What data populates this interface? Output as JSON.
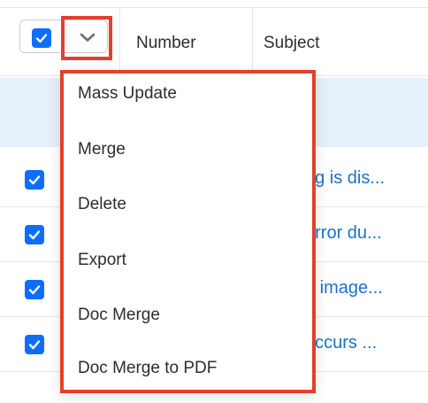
{
  "table": {
    "columns": {
      "number": "Number",
      "subject": "Subject"
    },
    "rows": [
      {
        "subject": "ng is dis..."
      },
      {
        "subject": "error du..."
      },
      {
        "subject": "n image..."
      },
      {
        "subject": "occurs ..."
      }
    ]
  },
  "actions_menu": {
    "items": [
      {
        "label": "Mass Update"
      },
      {
        "label": "Merge"
      },
      {
        "label": "Delete"
      },
      {
        "label": "Export"
      },
      {
        "label": "Doc Merge"
      },
      {
        "label": "Doc Merge to PDF"
      }
    ]
  },
  "icons": {
    "select_all": "checkbox-checked-icon",
    "actions": "chevron-down-icon",
    "row_select": "checkbox-checked-icon"
  },
  "colors": {
    "accent": "#0d6efd",
    "link": "#1a73c8",
    "highlight": "#e0412e",
    "band": "#e6f0fa"
  }
}
